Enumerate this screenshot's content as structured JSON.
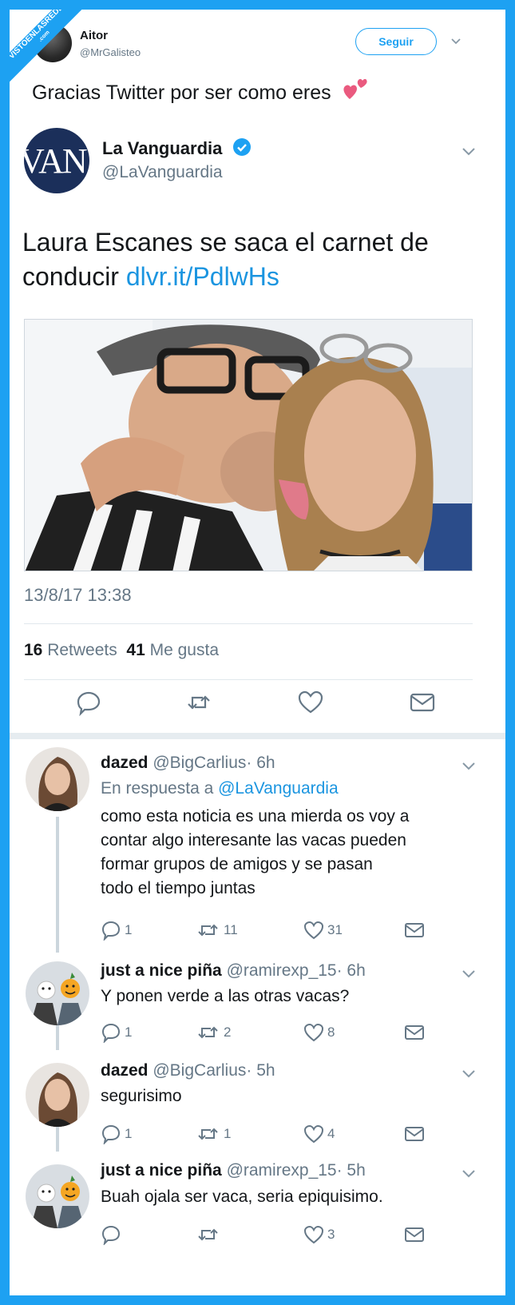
{
  "watermark": {
    "line1": "VISTOENLASREDES",
    "line2": ".com"
  },
  "tweet": {
    "author": {
      "name": "Aitor",
      "handle": "@MrGalisteo"
    },
    "follow_label": "Seguir",
    "text": "Gracias Twitter por ser como eres",
    "emoji": "two-hearts-icon"
  },
  "quoted": {
    "author": {
      "name": "La Vanguardia",
      "handle": "@LaVanguardia",
      "avatar_text": "VAN",
      "verified": true
    },
    "text": "Laura Escanes se saca el carnet de conducir",
    "link": "dlvr.it/PdlwHs",
    "date": "13/8/17 13:38",
    "retweets": "16",
    "retweets_label": "Retweets",
    "likes": "41",
    "likes_label": "Me gusta"
  },
  "replies": [
    {
      "name": "dazed",
      "handle": "@BigCarlius",
      "time": "· 6h",
      "reply_to_prefix": "En respuesta a",
      "reply_to": "@LaVanguardia",
      "text_lines": [
        "como esta noticia es una mierda os voy a",
        "contar algo interesante las vacas pueden",
        "formar grupos de amigos y se pasan",
        "todo el tiempo juntas"
      ],
      "replies": "1",
      "retweets": "11",
      "likes": "31"
    },
    {
      "name": "just a nice piña",
      "handle": "@ramirexp_15",
      "time": "· 6h",
      "text_lines": [
        "Y ponen verde a las otras vacas?"
      ],
      "replies": "1",
      "retweets": "2",
      "likes": "8"
    },
    {
      "name": "dazed",
      "handle": "@BigCarlius",
      "time": "· 5h",
      "text_lines": [
        "segurisimo"
      ],
      "replies": "1",
      "retweets": "1",
      "likes": "4"
    },
    {
      "name": "just a nice piña",
      "handle": "@ramirexp_15",
      "time": "· 5h",
      "text_lines": [
        "Buah ojala ser vaca, seria epiquisimo."
      ],
      "replies": "",
      "retweets": "",
      "likes": "3"
    }
  ],
  "colors": {
    "accent": "#1da1f2",
    "link": "#1b95e0",
    "muted": "#657786",
    "text": "#14171a"
  }
}
